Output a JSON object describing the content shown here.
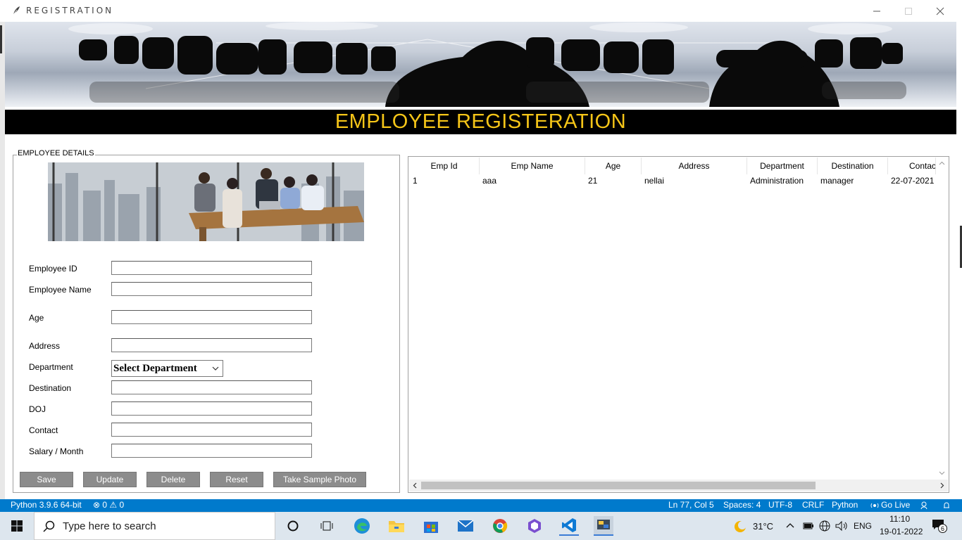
{
  "window": {
    "title": "REGISTRATION",
    "icons": [
      "feather-icon",
      "minimize-icon",
      "maximize-icon",
      "close-icon"
    ]
  },
  "heading": "EMPLOYEE REGISTERATION",
  "colors": {
    "heading_bg": "#000000",
    "heading_text": "#f5c518",
    "button_bg": "#8c8c8c",
    "statusbar_bg": "#007acc"
  },
  "details": {
    "legend": "EMPLOYEE DETAILS",
    "fields": [
      {
        "label": "Employee ID",
        "value": ""
      },
      {
        "label": "Employee Name",
        "value": ""
      },
      {
        "label": "Age",
        "value": ""
      },
      {
        "label": "Address",
        "value": ""
      },
      {
        "label": "Department",
        "value": "Select Department"
      },
      {
        "label": "Destination",
        "value": ""
      },
      {
        "label": "DOJ",
        "value": ""
      },
      {
        "label": "Contact",
        "value": ""
      },
      {
        "label": "Salary / Month",
        "value": ""
      }
    ],
    "buttons": [
      "Save",
      "Update",
      "Delete",
      "Reset",
      "Take Sample Photo"
    ]
  },
  "table": {
    "columns": [
      "Emp Id",
      "Emp Name",
      "Age",
      "Address",
      "Department",
      "Destination",
      "Contact"
    ],
    "rows": [
      [
        "1",
        "aaa",
        "21",
        "nellai",
        "Administration",
        "manager",
        "22-07-2021"
      ]
    ]
  },
  "statusbar": {
    "python": "Python 3.9.6 64-bit",
    "problems": "⊗ 0 ⚠ 0",
    "position": "Ln 77, Col 5",
    "spaces": "Spaces: 4",
    "encoding": "UTF-8",
    "eol": "CRLF",
    "language": "Python",
    "golive": "Go Live"
  },
  "taskbar": {
    "search_placeholder": "Type here to search",
    "weather": "31°C",
    "lang": "ENG",
    "time": "11:10",
    "date": "19-01-2022",
    "notifications": "6"
  }
}
